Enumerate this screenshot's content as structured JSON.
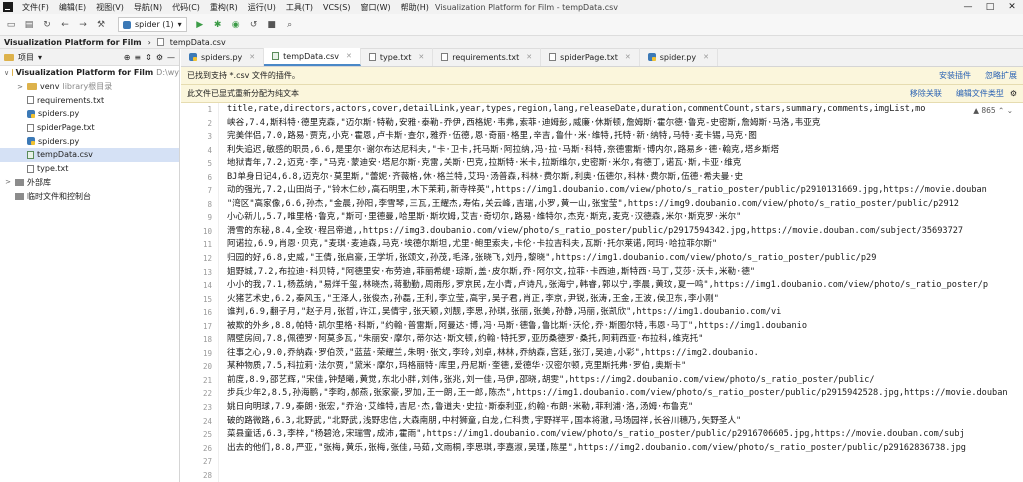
{
  "menu": {
    "items": [
      "文件(F)",
      "编辑(E)",
      "视图(V)",
      "导航(N)",
      "代码(C)",
      "重构(R)",
      "运行(U)",
      "工具(T)",
      "VCS(S)",
      "窗口(W)",
      "帮助(H)"
    ],
    "window_title": "Visualization Platform for Film - tempData.csv",
    "window_controls": [
      "—",
      "□",
      "✕"
    ]
  },
  "toolbar": {
    "run_config": "spider (1)"
  },
  "breadcrumb": {
    "project": "Visualization Platform for Film",
    "file": "tempData.csv"
  },
  "sidebar": {
    "header_label": "项目",
    "items": [
      {
        "text": "Visualization Platform for Film",
        "extra": "D:\\wy",
        "kind": "folder",
        "indent": 0,
        "arrow": "∨"
      },
      {
        "text": "venv",
        "extra": "library根目录",
        "kind": "folder",
        "indent": 1,
        "arrow": ">"
      },
      {
        "text": "requirements.txt",
        "extra": "",
        "kind": "txt",
        "indent": 1,
        "arrow": ""
      },
      {
        "text": "spiders.py",
        "extra": "",
        "kind": "py",
        "indent": 1,
        "arrow": ""
      },
      {
        "text": "spiderPage.txt",
        "extra": "",
        "kind": "txt",
        "indent": 1,
        "arrow": ""
      },
      {
        "text": "spiders.py",
        "extra": "",
        "kind": "py",
        "indent": 1,
        "arrow": ""
      },
      {
        "text": "tempData.csv",
        "extra": "",
        "kind": "csv",
        "indent": 1,
        "arrow": ""
      },
      {
        "text": "type.txt",
        "extra": "",
        "kind": "txt",
        "indent": 1,
        "arrow": ""
      },
      {
        "text": "外部库",
        "extra": "",
        "kind": "lib",
        "indent": 0,
        "arrow": ">"
      },
      {
        "text": "临时文件和控制台",
        "extra": "",
        "kind": "lib",
        "indent": 0,
        "arrow": ""
      }
    ]
  },
  "tabs": [
    {
      "label": "spiders.py",
      "kind": "py"
    },
    {
      "label": "tempData.csv",
      "kind": "csv",
      "active": true
    },
    {
      "label": "type.txt",
      "kind": "txt"
    },
    {
      "label": "requirements.txt",
      "kind": "txt"
    },
    {
      "label": "spiderPage.txt",
      "kind": "txt"
    },
    {
      "label": "spider.py",
      "kind": "py"
    }
  ],
  "notices": [
    {
      "text": "已找到支持 *.csv 文件的插件。",
      "links": [
        "安装插件",
        "忽略扩展"
      ]
    },
    {
      "text": "此文件已显式重新分配为纯文本",
      "links": [
        "移除关联",
        "编辑文件类型"
      ]
    }
  ],
  "editor": {
    "warning_count": "▲ 865",
    "line_numbers": [
      "1",
      "2",
      "3",
      "4",
      "5",
      "6",
      "7",
      "8",
      "9",
      "10",
      "11",
      "12",
      "13",
      "14",
      "15",
      "16",
      "17",
      "18",
      "19",
      "20",
      "21",
      "22",
      "23",
      "24",
      "25",
      "26",
      "27",
      "28"
    ],
    "lines": [
      "title,rate,directors,actors,cover,detailLink,year,types,region,lang,releaseDate,duration,commentCount,stars,summary,comments,imgList,mo",
      "峡谷,7.4,斯科特·德里克森,\"迈尔斯·特勒,安雅·泰勒-乔伊,西格妮·韦弗,索菲·迪姆彭,威廉·休斯顿,詹姆斯·霍尔德·鲁克-史密斯,詹姆斯·马洛,韦亚克",
      "完美伴侣,7.0,路易·贾克,小克·霍恩,卢卡斯·查尔,雅乔·伍德,恩·奇丽·格里,辛吉,鲁什·米·维特,托特·新·纳特,马特·麦卡锡,马克·图",
      "利失追迟,敏感的职员,6.6,是里尔·谢尔布达尼科夫,\"卡·卫卡,托马斯·阿拉纳,冯·拉·马斯·科特,奈德雷斯·博内尔,路易乡·德·翰克,塔乡斯塔",
      "地狱青年,7.2,迈克·李,\"马克·蒙迪安·塔尼尔斯·克雷,关斯·巴克,拉斯特·米卡,拉斯维尔,史密斯·米尔,有德丁,诺瓦·斯,卡亚·维克",
      "BJ单身日记4,6.8,迈克尔·莫里斯,\"蕾妮·齐薇格,休·格兰特,艾玛·汤普森,科林·费尔斯,利奥·伍德尔,科林·费尔斯,伍德·希夫曼·史",
      "动的强光,7.2,山田尚子,\"铃木仁纱,高石明里,木下茉莉,新寺梓英\",https://img1.doubanio.com/view/photo/s_ratio_poster/public/p2910131669.jpg,https://movie.douban",
      "\"湾区\"高家像,6.6,孙杰,\"金晨,孙阳,李雪琴,三瓦,王耀杰,寿佑,关云峰,吉瑞,小罗,黄一山,张宝莹\",https://img9.doubanio.com/view/photo/s_ratio_poster/public/p2912",
      "小心新儿,5.7,唯里格·鲁克,\"斯可·里德曼,哈里斯·斯坎姆,艾吉·奇切尔,路易·维特尔,杰克·斯克,麦克·汉德森,米尔·斯克罗·米尔\"",
      "滑雪的东秘,8.4,全玫·程吕帝道,,https://img3.doubanio.com/view/photo/s_ratio_poster/public/p2917594342.jpg,https://movie.douban.com/subject/35693727",
      "阿诺拉,6.9,肖恩·贝克,\"麦琪·麦迪森,马克·埃德尔斯坦,尤里·鲍里索夫,卡伦·卡拉吉科夫,瓦斯·托尔莱诺,阿玛·哈拉菲尔斯\"",
      "归园的好,6.8,史威,\"王倩,张启豪,王学圻,张颂文,孙茂,毛泽,张晓飞,刘丹,黎晓\",https://img1.doubanio.com/view/photo/s_ratio_poster/public/p29",
      "姐野城,7.2,布拉迪·科贝特,\"阿德里安·布劳迪,菲丽希缇·琼斯,盖·皮尔斯,乔·阿尔文,拉菲·卡西迪,斯特西·马丁,艾莎·沃卡,米勒·德\"",
      "小小的我,7.1,杨荔纳,\"易烊千玺,林晓杰,蒋勤勤,周雨彤,罗京民,左小青,卢诗凡,张海宁,韩睿,郭以宁,李晨,黄玟,夏一鸣\",https://img1.doubanio.com/view/photo/s_ratio_poster/p",
      "火猪艺术史,6.2,秦风玉,\"王泽人,张俊杰,孙磊,王利,李立莹,高宇,吴子君,肖正,李京,尹锐,张涛,王金,王波,侯卫东,李小刚\"",
      "谁判,6.9,翻子月,\"赵子月,张哲,许江,吴倩宇,张天颖,刘靓,李思,孙琪,张丽,张美,孙静,冯丽,张凯欣\",https://img1.doubanio.com/vi",
      "被欺的外乡,8.8,帕特·凯尔里格·科斯,\"约翰·普雷斯,阿曼达·博,冯·马斯·德鲁,鲁比斯·沃伦,乔·斯图尔特,韦恩·马丁\",https://img1.doubanio",
      "隔壁房间,7.8,佩德罗·阿莫多瓦,\"朱丽安·摩尔,蒂尔达·斯文顿,约翰·特托罗,亚历桑德罗·桑托,阿莉西亚·布拉科,维克托\"",
      "往事之心,9.0,乔纳森·罗伯茨,\"蓝蓝·荣耀兰,朱明·张文,李玲,刘卓,林林,乔纳森,宫廷,张汀,吴迪,小彩\",https://img2.doubanio.",
      "某种物质,7.5,科拉莉·法尔贾,\"黛米·摩尔,玛格丽特·库里,丹尼斯·奎德,爱德华·汉密尔顿,克里斯托弗·罗伯,奥斯卡\"",
      "前度,8.9,邵艺辉,\"宋佳,钟楚曦,黄觉,东北小胖,刘伟,张兆,刘一佳,马伊,邵晓,胡雯\",https://img2.doubanio.com/view/photo/s_ratio_poster/public/",
      "步兵少年2,8.5,孙海鹏,\"李昀,郝燕,张家豪,罗加,王一朗,王一郎,陈杰\",https://img1.doubanio.com/view/photo/s_ratio_poster/public/p2915942528.jpg,https://movie.douban",
      "姚日向明球,7.9,秦朗·张宏,\"乔治·艾维特,吉尼·杰,鲁道夫·史拉·斯泰利亚,约翰·布朗·米勒,菲利浦·洛,汤姆·布鲁克\"",
      "破的路微路,6.3,北野武,\"北野武,浅野忠信,大森南朋,中村狮童,白龙,仁科贵,宇野祥平,国本将澈,马场园祥,长谷川穗乃,矢野圣人\"",
      "菜县童话,6.3,李梓,\"杨碧沧,宋瑞雪,成沛,霍雨\",https://img1.doubanio.com/view/photo/s_ratio_poster/public/p2916706605.jpg,https://movie.douban.com/subj",
      "出去的他们,8.8,严亚,\"张梅,黄乐,张梅,张佳,马茹,文雨桐,李思琪,李嘉淑,吴瑾,陈星\",https://img2.doubanio.com/view/photo/s_ratio_poster/public/p29162836738.jpg"
    ]
  }
}
